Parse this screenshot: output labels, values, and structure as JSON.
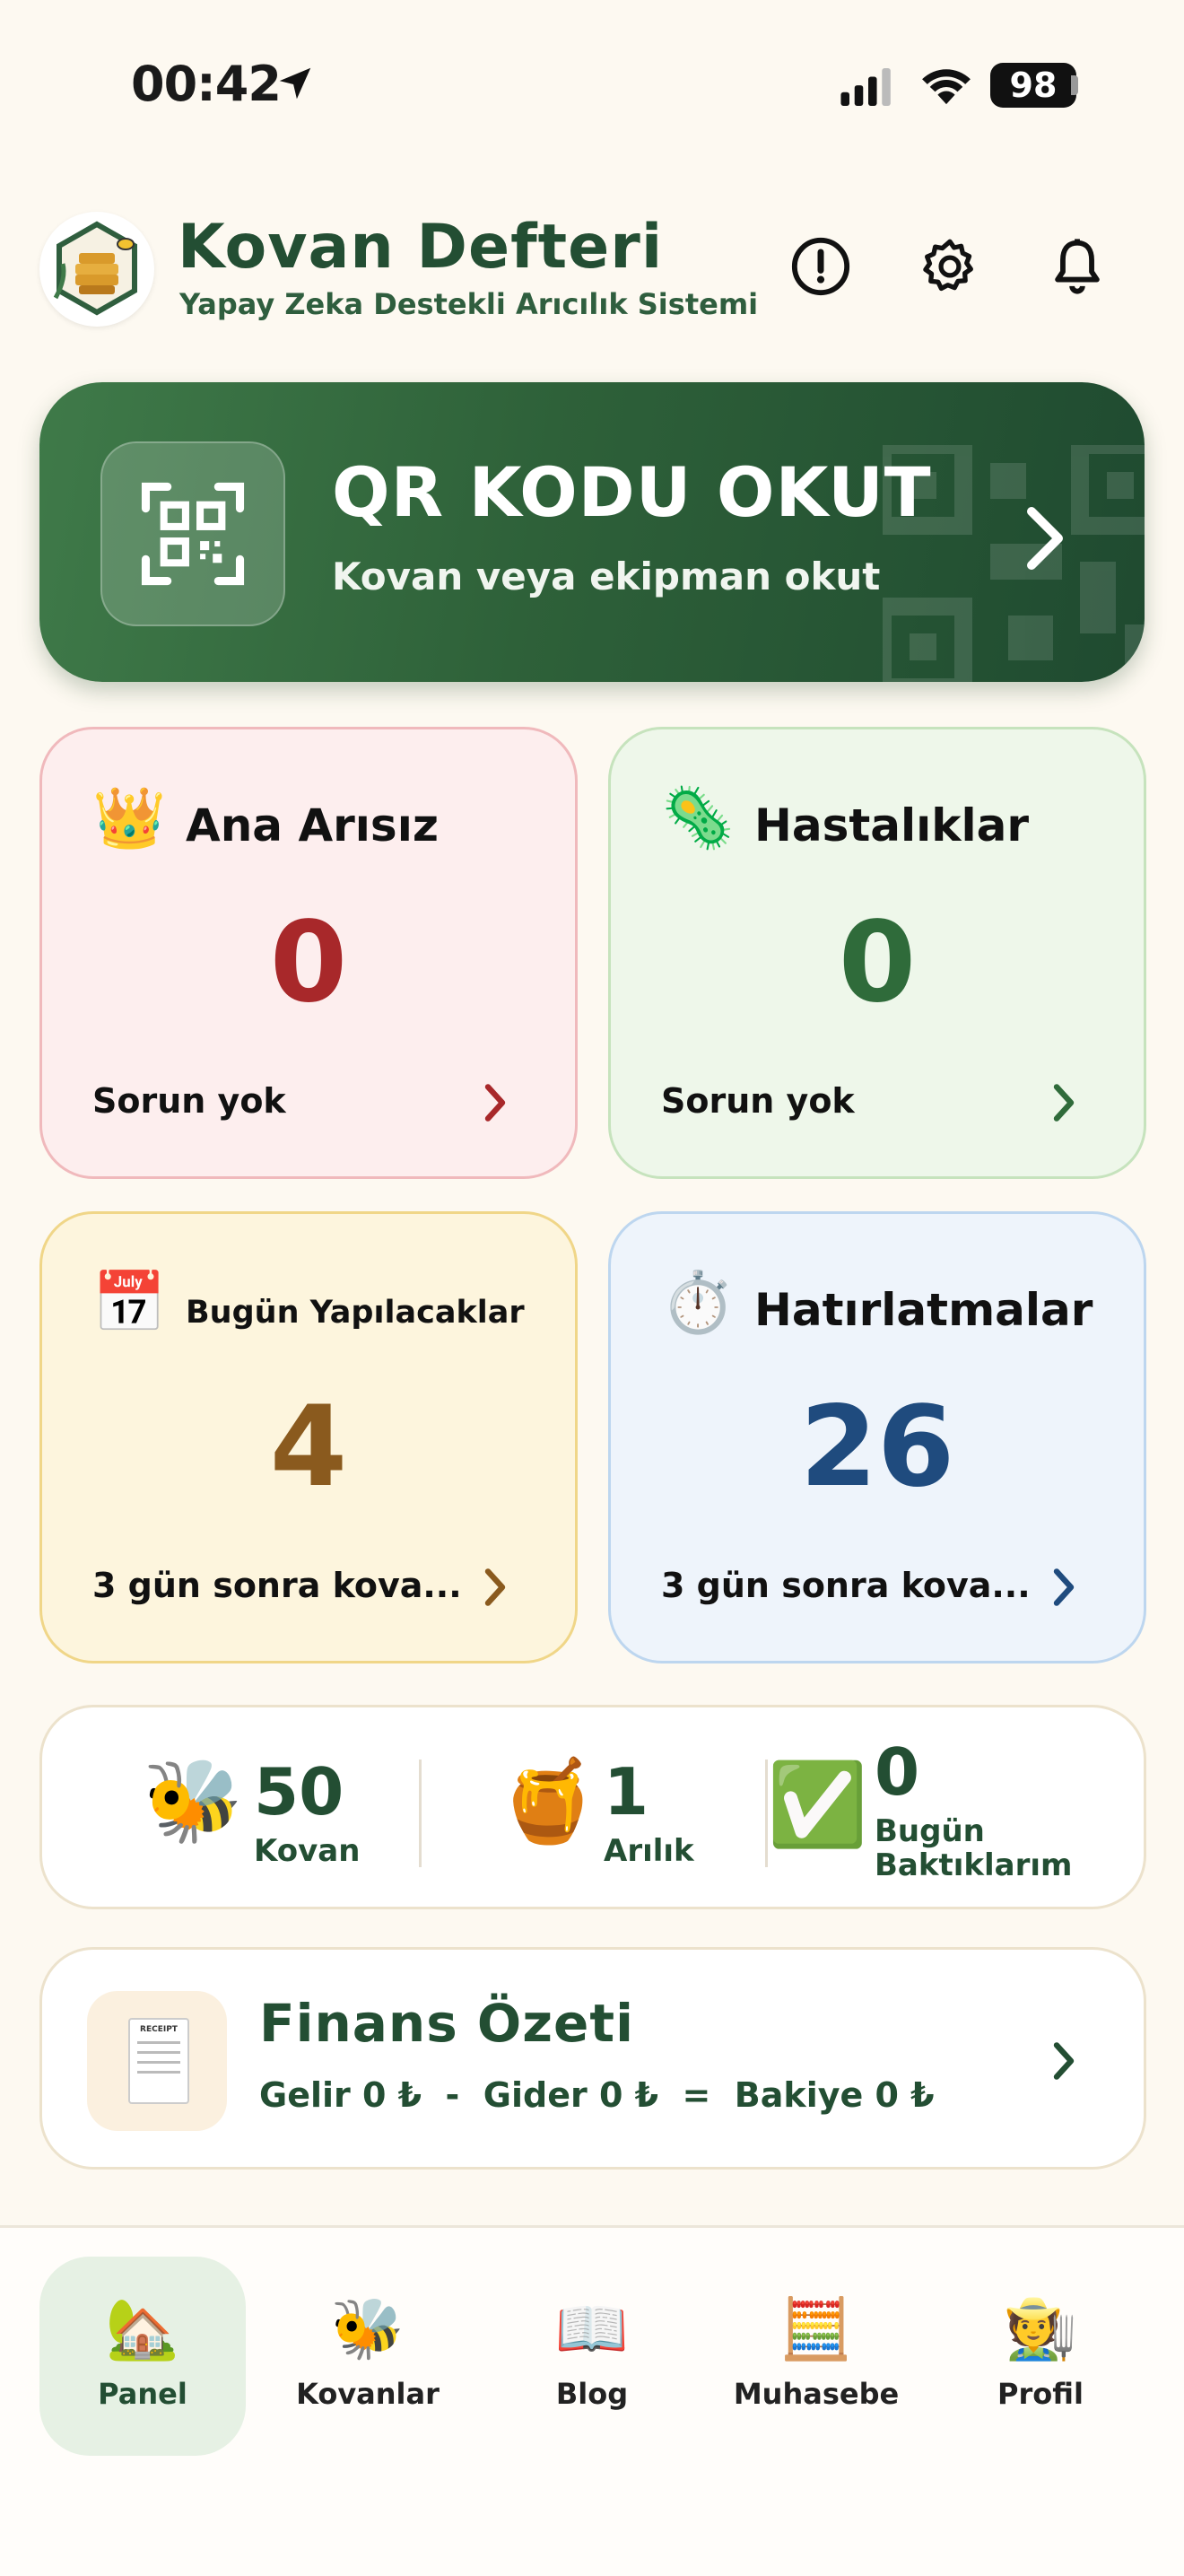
{
  "status_bar": {
    "time": "00:42",
    "battery": "98"
  },
  "header": {
    "app_title": "Kovan Defteri",
    "app_subtitle": "Yapay Zeka Destekli Arıcılık Sistemi",
    "icons": [
      "alert-circle-icon",
      "gear-icon",
      "bell-icon"
    ]
  },
  "qr_banner": {
    "title": "QR KODU OKUT",
    "subtitle": "Kovan veya ekipman okut"
  },
  "cards": {
    "queenless": {
      "emoji": "👑",
      "title": "Ana Arısız",
      "value": "0",
      "footer": "Sorun yok",
      "color": "#a8282a"
    },
    "diseases": {
      "emoji": "🦠",
      "title": "Hastalıklar",
      "value": "0",
      "footer": "Sorun yok",
      "color": "#2f6b3a"
    },
    "today": {
      "emoji": "📅",
      "title": "Bugün Yapılacaklar",
      "value": "4",
      "footer": "3 gün sonra kova...",
      "color": "#8a5a1e"
    },
    "reminders": {
      "emoji": "⏱️",
      "title": "Hatırlatmalar",
      "value": "26",
      "footer": "3 gün sonra kova...",
      "color": "#1f4b7e"
    }
  },
  "summary": {
    "hives": {
      "emoji": "🐝",
      "value": "50",
      "label": "Kovan"
    },
    "apiaries": {
      "emoji": "🍯",
      "value": "1",
      "label": "Arılık"
    },
    "checked_today": {
      "emoji": "✅",
      "value": "0",
      "label_line1": "Bugün",
      "label_line2": "Baktıklarım"
    }
  },
  "finance": {
    "title": "Finans Özeti",
    "summary_line": "Gelir 0 ₺  -  Gider 0 ₺  =  Bakiye 0 ₺",
    "receipt_text": "RECEIPT"
  },
  "tabbar": {
    "items": [
      {
        "emoji": "🏡",
        "label": "Panel",
        "active": true
      },
      {
        "emoji": "🐝",
        "label": "Kovanlar",
        "active": false
      },
      {
        "emoji": "📖",
        "label": "Blog",
        "active": false
      },
      {
        "emoji": "🧮",
        "label": "Muhasebe",
        "active": false
      },
      {
        "emoji": "🧑‍🌾",
        "label": "Profil",
        "active": false
      }
    ]
  },
  "colors": {
    "brand_green": "#234e33",
    "background": "#fdf9f1"
  }
}
